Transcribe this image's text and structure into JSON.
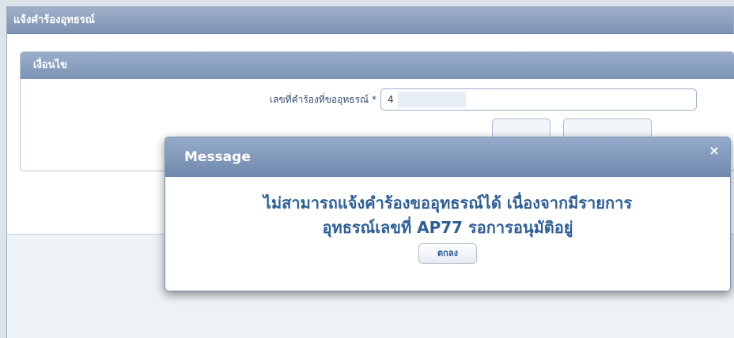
{
  "page": {
    "title": "แจ้งคำร้องอุทธรณ์"
  },
  "conditions_panel": {
    "title": "เงื่อนไข",
    "field_label": "เลขที่คำร้องที่ขออุทธรณ์ *",
    "field_value": "4"
  },
  "dialog": {
    "title": "Message",
    "close_label": "×",
    "message_lines": [
      "ไม่สามารถแจ้งคำร้องขออุทธรณ์ได้ เนื่องจากมีรายการ",
      "อุทธรณ์เลขที่ AP77 รอการอนุมัติอยู่"
    ],
    "ok_label": "ตกลง"
  }
}
